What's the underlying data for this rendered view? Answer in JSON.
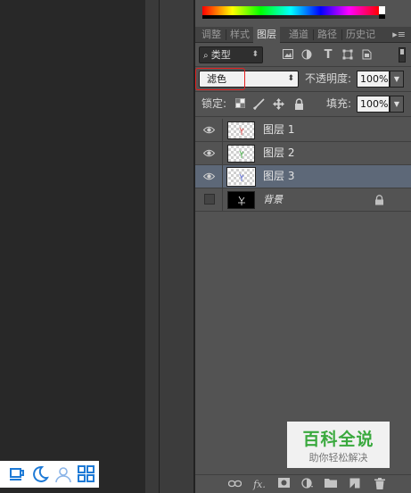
{
  "tabs": [
    "调整",
    "样式",
    "图层",
    "通道",
    "路径",
    "历史记"
  ],
  "active_tab": "图层",
  "panel_menu_icon": "panel-menu-icon",
  "filter": {
    "kind_label": "类型",
    "icons": [
      "image-filter-icon",
      "adjustment-filter-icon",
      "type-filter-icon",
      "shape-filter-icon",
      "smart-object-filter-icon"
    ]
  },
  "blend": {
    "mode": "滤色",
    "opacity_label": "不透明度:",
    "opacity_value": "100%"
  },
  "lock": {
    "label": "锁定:",
    "icons": [
      "lock-transparent-icon",
      "lock-brush-icon",
      "lock-move-icon",
      "lock-all-icon"
    ],
    "fill_label": "填充:",
    "fill_value": "100%"
  },
  "layers": [
    {
      "name": "图层 1",
      "visible": true,
      "selected": false
    },
    {
      "name": "图层 2",
      "visible": true,
      "selected": false
    },
    {
      "name": "图层 3",
      "visible": true,
      "selected": true
    },
    {
      "name": "背景",
      "visible": false,
      "selected": false,
      "locked": true
    }
  ],
  "bottom_icons": [
    "link-layers-icon",
    "fx-icon",
    "add-mask-icon",
    "adjustment-layer-icon",
    "group-folder-icon",
    "new-layer-icon",
    "trash-icon"
  ],
  "watermark": {
    "title": "百科全说",
    "subtitle": "助你轻松解决"
  },
  "taskbar_icons": [
    "cup-icon",
    "moon-icon",
    "user-icon",
    "grid-icon"
  ],
  "colors": {
    "panel_bg": "#535353",
    "selected_layer": "#5d6878",
    "highlight": "#e52020",
    "brand_green": "#3aa93e"
  }
}
